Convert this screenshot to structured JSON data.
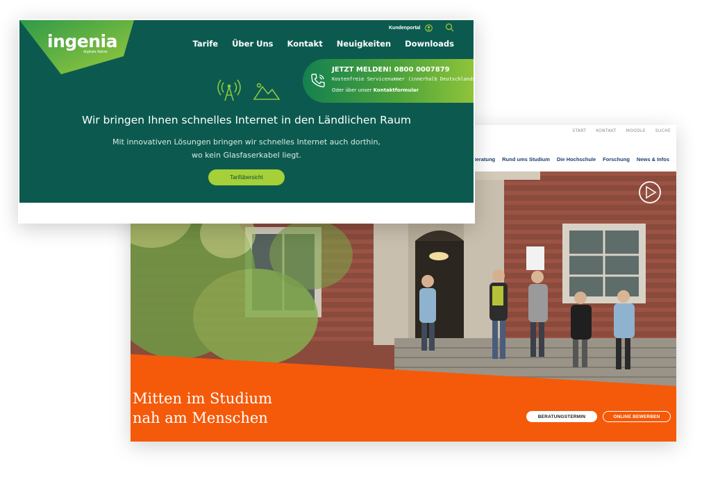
{
  "ingenia": {
    "logo": "ingenia",
    "logo_sub": "digitale Netze",
    "portal": "Kundenportal",
    "nav": [
      "Tarife",
      "Über Uns",
      "Kontakt",
      "Neuigkeiten",
      "Downloads"
    ],
    "call_title": "JETZT MELDEN! 0800 0007879",
    "call_sub": "Kostenfreie Servicenummer (innerhalb Deutschlands)",
    "call_alt_prefix": "Oder über unser",
    "call_alt_link": "Kontaktformular",
    "heading": "Wir bringen Ihnen schnelles Internet in den Ländlichen Raum",
    "sub_line1": "Mit innovativen Lösungen bringen wir schnelles Internet auch dorthin,",
    "sub_line2": "wo kein Glasfaserkabel liegt.",
    "cta": "Tarifübersicht",
    "colors": {
      "primary": "#0c5a4f",
      "accent": "#a6d038",
      "logo_green": "#8cc63f"
    },
    "icons": [
      "search-icon",
      "user-icon",
      "phone-icon",
      "antenna-icon",
      "landscape-icon"
    ]
  },
  "uni": {
    "utility": [
      "START",
      "KONTAKT",
      "MOODLE",
      "SUCHE"
    ],
    "nav": [
      "ng",
      "Beratung",
      "Rund ums Studium",
      "Die Hochschule",
      "Forschung",
      "News & Infos"
    ],
    "headline1": "Mitten im Studium",
    "headline2": "nah am Menschen",
    "btn1": "BERATUNGSTERMIN",
    "btn2": "ONLINE BEWERBEN",
    "colors": {
      "orange": "#f45a0a",
      "nav": "#1c3f6e"
    },
    "icons": [
      "play-icon"
    ]
  }
}
